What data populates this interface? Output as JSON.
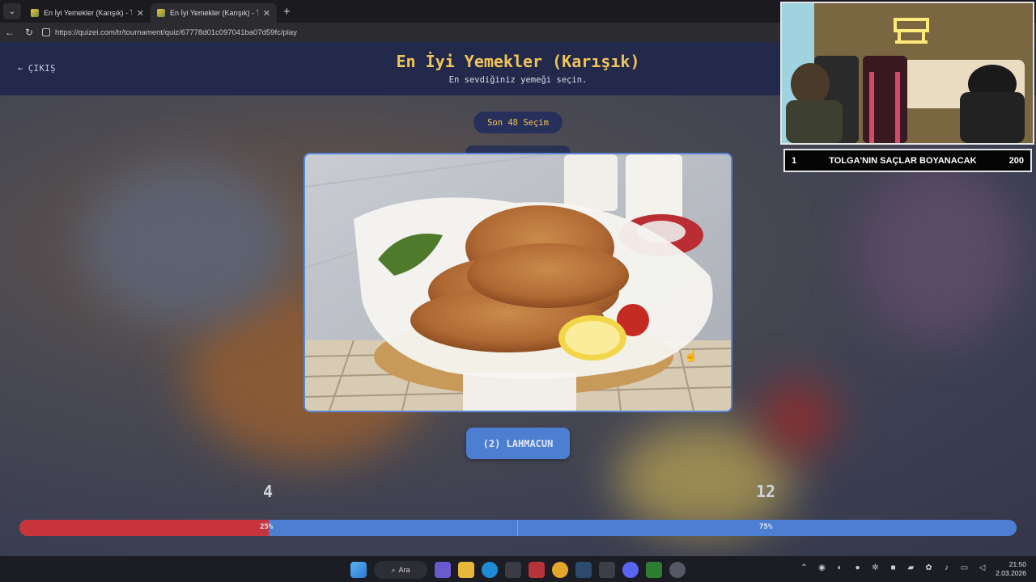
{
  "browser": {
    "tabs": [
      {
        "title": "En İyi Yemekler (Karışık) - Tier List..."
      },
      {
        "title": "En İyi Yemekler (Karışık) - Tier List..."
      }
    ],
    "new_tab_symbol": "+",
    "tab_menu_symbol": "⌄",
    "url": "https://quizei.com/tr/tournament/quiz/67778d01c097041ba07d59fc/play"
  },
  "header": {
    "exit_label": "ÇIKIŞ",
    "title": "En İyi Yemekler (Karışık)",
    "subtitle": "En sevdiğiniz yemeği seçin."
  },
  "round": {
    "label": "Son 48 Seçim"
  },
  "choice": {
    "button_label": "(2) LAHMACUN",
    "image_alt": "lahmacun-photo"
  },
  "votes": {
    "left_count": "4",
    "right_count": "12",
    "left_percent_label": "25%",
    "right_percent_label": "75%",
    "left_fraction": 0.25,
    "left_color": "#c8343c",
    "right_color": "#4c7fd1"
  },
  "stream_overlay": {
    "rank": "1",
    "message": "TOLGA'NIN SAÇLAR BOYANACAK",
    "amount": "200"
  },
  "taskbar": {
    "search_label": "Ara",
    "time": "21:50",
    "date": "2.03.2026"
  },
  "colors": {
    "accent_gold": "#f0c45a",
    "header_bg": "#23294a",
    "button_blue": "#4c7fd1"
  }
}
